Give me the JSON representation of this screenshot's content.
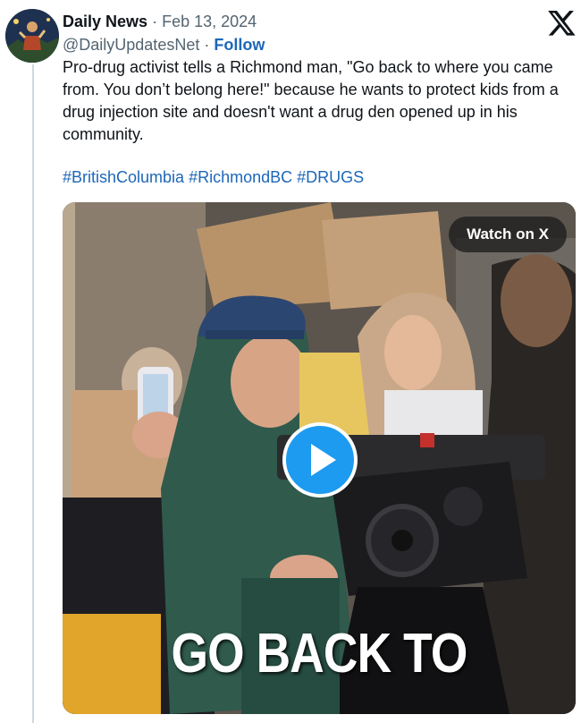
{
  "tweet": {
    "display_name": "Daily News",
    "date": "Feb 13, 2024",
    "separator": "·",
    "handle": "@DailyUpdatesNet",
    "follow_label": "Follow",
    "text": "Pro-drug activist tells a Richmond man, \"Go back to where you came from. You don’t belong here!\" because he wants to protect kids from a drug injection site and doesn't want a drug den opened up in his community.",
    "hashtags": [
      "#BritishColumbia",
      "#RichmondBC",
      "#DRUGS"
    ]
  },
  "media": {
    "watch_label": "Watch on X",
    "caption": "GO BACK TO",
    "play_icon": "play-icon"
  },
  "icons": {
    "brand": "x-logo-icon",
    "avatar": "avatar"
  },
  "colors": {
    "link": "#1d67b8",
    "play_button": "#1d9bf0",
    "muted_text": "#536471"
  }
}
